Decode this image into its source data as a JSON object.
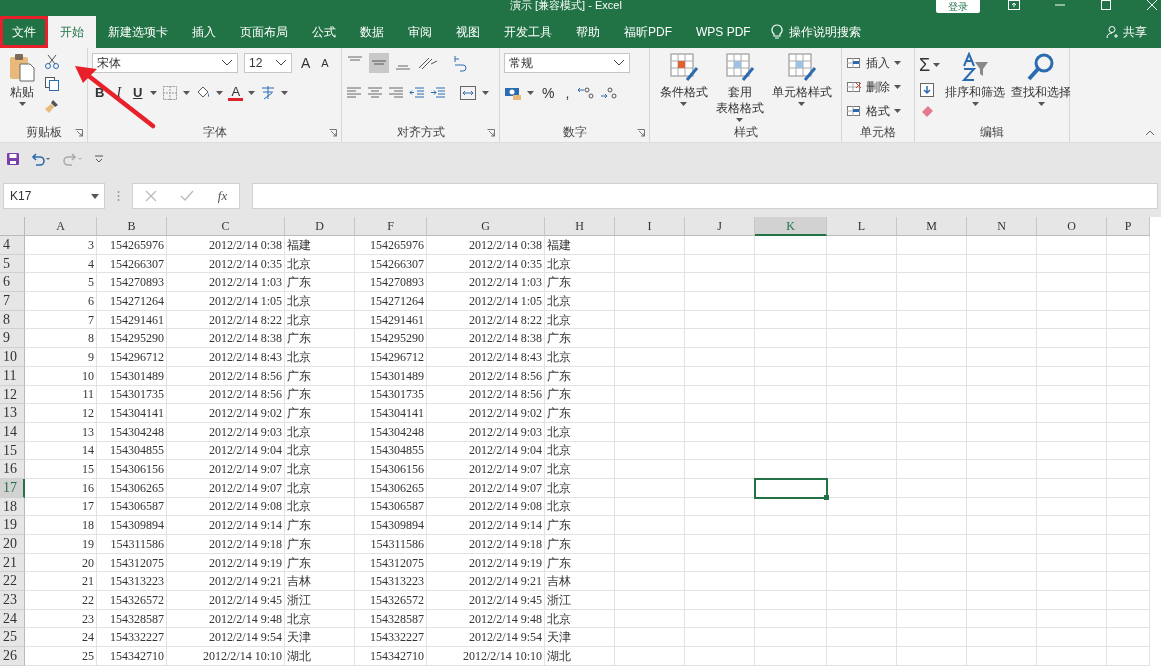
{
  "window": {
    "title": "演示 [兼容模式] - Excel",
    "sign_in": "登录"
  },
  "tabs": [
    {
      "label": "文件",
      "selected": false,
      "highlighted": true
    },
    {
      "label": "开始",
      "selected": true,
      "highlighted": false
    },
    {
      "label": "新建选项卡",
      "selected": false,
      "highlighted": false
    },
    {
      "label": "插入",
      "selected": false,
      "highlighted": false
    },
    {
      "label": "页面布局",
      "selected": false,
      "highlighted": false
    },
    {
      "label": "公式",
      "selected": false,
      "highlighted": false
    },
    {
      "label": "数据",
      "selected": false,
      "highlighted": false
    },
    {
      "label": "审阅",
      "selected": false,
      "highlighted": false
    },
    {
      "label": "视图",
      "selected": false,
      "highlighted": false
    },
    {
      "label": "开发工具",
      "selected": false,
      "highlighted": false
    },
    {
      "label": "帮助",
      "selected": false,
      "highlighted": false
    },
    {
      "label": "福昕PDF",
      "selected": false,
      "highlighted": false
    },
    {
      "label": "WPS PDF",
      "selected": false,
      "highlighted": false
    }
  ],
  "tell_me": "操作说明搜索",
  "share": "共享",
  "ribbon": {
    "clipboard": {
      "label": "剪贴板",
      "paste": "粘贴"
    },
    "font": {
      "label": "字体",
      "family": "宋体",
      "size": "12",
      "grow": "A",
      "shrink": "A",
      "bold": "B",
      "italic": "I",
      "underline": "U",
      "color_letter": "A"
    },
    "alignment": {
      "label": "对齐方式"
    },
    "number": {
      "label": "数字",
      "format": "常规",
      "percent": "%",
      "comma": ","
    },
    "styles": {
      "label": "样式",
      "buttons": [
        {
          "lines": [
            "条件格式"
          ]
        },
        {
          "lines": [
            "套用",
            "表格格式"
          ]
        },
        {
          "lines": [
            "单元格样式"
          ]
        }
      ]
    },
    "cells": {
      "label": "单元格",
      "buttons": [
        "插入",
        "删除",
        "格式"
      ]
    },
    "editing": {
      "label": "编辑",
      "sum": "Σ",
      "buttons": [
        "排序和筛选",
        "查找和选择"
      ]
    }
  },
  "formula_bar": {
    "name_box": "K17",
    "fx": "fx"
  },
  "columns": [
    {
      "label": "A",
      "selected": false
    },
    {
      "label": "B",
      "selected": false
    },
    {
      "label": "C",
      "selected": false
    },
    {
      "label": "D",
      "selected": false
    },
    {
      "label": "F",
      "selected": false
    },
    {
      "label": "G",
      "selected": false
    },
    {
      "label": "H",
      "selected": false
    },
    {
      "label": "I",
      "selected": false
    },
    {
      "label": "J",
      "selected": false
    },
    {
      "label": "K",
      "selected": true
    },
    {
      "label": "L",
      "selected": false
    },
    {
      "label": "M",
      "selected": false
    },
    {
      "label": "N",
      "selected": false
    },
    {
      "label": "O",
      "selected": false
    },
    {
      "label": "P",
      "selected": false
    }
  ],
  "rows": [
    {
      "number": "4",
      "selected": false,
      "cells": [
        "3",
        "154265976",
        "2012/2/14 0:38",
        "福建",
        "154265976",
        "2012/2/14 0:38",
        "福建"
      ]
    },
    {
      "number": "5",
      "selected": false,
      "cells": [
        "4",
        "154266307",
        "2012/2/14 0:35",
        "北京",
        "154266307",
        "2012/2/14 0:35",
        "北京"
      ]
    },
    {
      "number": "6",
      "selected": false,
      "cells": [
        "5",
        "154270893",
        "2012/2/14 1:03",
        "广东",
        "154270893",
        "2012/2/14 1:03",
        "广东"
      ]
    },
    {
      "number": "7",
      "selected": false,
      "cells": [
        "6",
        "154271264",
        "2012/2/14 1:05",
        "北京",
        "154271264",
        "2012/2/14 1:05",
        "北京"
      ]
    },
    {
      "number": "8",
      "selected": false,
      "cells": [
        "7",
        "154291461",
        "2012/2/14 8:22",
        "北京",
        "154291461",
        "2012/2/14 8:22",
        "北京"
      ]
    },
    {
      "number": "9",
      "selected": false,
      "cells": [
        "8",
        "154295290",
        "2012/2/14 8:38",
        "广东",
        "154295290",
        "2012/2/14 8:38",
        "广东"
      ]
    },
    {
      "number": "10",
      "selected": false,
      "cells": [
        "9",
        "154296712",
        "2012/2/14 8:43",
        "北京",
        "154296712",
        "2012/2/14 8:43",
        "北京"
      ]
    },
    {
      "number": "11",
      "selected": false,
      "cells": [
        "10",
        "154301489",
        "2012/2/14 8:56",
        "广东",
        "154301489",
        "2012/2/14 8:56",
        "广东"
      ]
    },
    {
      "number": "12",
      "selected": false,
      "cells": [
        "11",
        "154301735",
        "2012/2/14 8:56",
        "广东",
        "154301735",
        "2012/2/14 8:56",
        "广东"
      ]
    },
    {
      "number": "13",
      "selected": false,
      "cells": [
        "12",
        "154304141",
        "2012/2/14 9:02",
        "广东",
        "154304141",
        "2012/2/14 9:02",
        "广东"
      ]
    },
    {
      "number": "14",
      "selected": false,
      "cells": [
        "13",
        "154304248",
        "2012/2/14 9:03",
        "北京",
        "154304248",
        "2012/2/14 9:03",
        "北京"
      ]
    },
    {
      "number": "15",
      "selected": false,
      "cells": [
        "14",
        "154304855",
        "2012/2/14 9:04",
        "北京",
        "154304855",
        "2012/2/14 9:04",
        "北京"
      ]
    },
    {
      "number": "16",
      "selected": false,
      "cells": [
        "15",
        "154306156",
        "2012/2/14 9:07",
        "北京",
        "154306156",
        "2012/2/14 9:07",
        "北京"
      ]
    },
    {
      "number": "17",
      "selected": true,
      "cells": [
        "16",
        "154306265",
        "2012/2/14 9:07",
        "北京",
        "154306265",
        "2012/2/14 9:07",
        "北京"
      ]
    },
    {
      "number": "18",
      "selected": false,
      "cells": [
        "17",
        "154306587",
        "2012/2/14 9:08",
        "北京",
        "154306587",
        "2012/2/14 9:08",
        "北京"
      ]
    },
    {
      "number": "19",
      "selected": false,
      "cells": [
        "18",
        "154309894",
        "2012/2/14 9:14",
        "广东",
        "154309894",
        "2012/2/14 9:14",
        "广东"
      ]
    },
    {
      "number": "20",
      "selected": false,
      "cells": [
        "19",
        "154311586",
        "2012/2/14 9:18",
        "广东",
        "154311586",
        "2012/2/14 9:18",
        "广东"
      ]
    },
    {
      "number": "21",
      "selected": false,
      "cells": [
        "20",
        "154312075",
        "2012/2/14 9:19",
        "广东",
        "154312075",
        "2012/2/14 9:19",
        "广东"
      ]
    },
    {
      "number": "22",
      "selected": false,
      "cells": [
        "21",
        "154313223",
        "2012/2/14 9:21",
        "吉林",
        "154313223",
        "2012/2/14 9:21",
        "吉林"
      ]
    },
    {
      "number": "23",
      "selected": false,
      "cells": [
        "22",
        "154326572",
        "2012/2/14 9:45",
        "浙江",
        "154326572",
        "2012/2/14 9:45",
        "浙江"
      ]
    },
    {
      "number": "24",
      "selected": false,
      "cells": [
        "23",
        "154328587",
        "2012/2/14 9:48",
        "北京",
        "154328587",
        "2012/2/14 9:48",
        "北京"
      ]
    },
    {
      "number": "25",
      "selected": false,
      "cells": [
        "24",
        "154332227",
        "2012/2/14 9:54",
        "天津",
        "154332227",
        "2012/2/14 9:54",
        "天津"
      ]
    },
    {
      "number": "26",
      "selected": false,
      "cells": [
        "25",
        "154342710",
        "2012/2/14 10:10",
        "湖北",
        "154342710",
        "2012/2/14 10:10",
        "湖北"
      ]
    }
  ]
}
